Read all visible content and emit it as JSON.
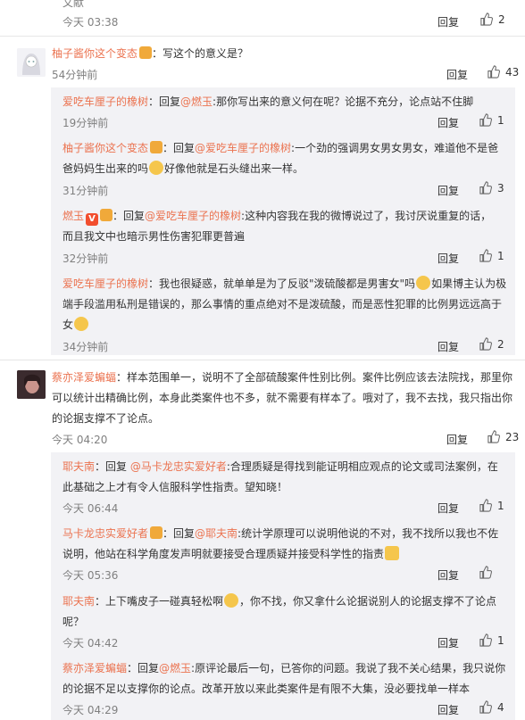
{
  "top": {
    "text": "文献",
    "time": "今天 03:38",
    "reply": "回复",
    "likes": "2"
  },
  "c1": {
    "user": "柚子酱你这个变态",
    "text": "：写这个的意义是？",
    "time": "54分钟前",
    "reply": "回复",
    "likes": "43",
    "replies": [
      {
        "user": "爱吃车厘子的橡树",
        "text1": "：回复",
        "mention": "@燃玉",
        "text2": ":那你写出来的意义何在呢？论据不充分，论点站不住脚",
        "time": "19分钟前",
        "reply": "回复",
        "likes": "1"
      },
      {
        "user": "柚子酱你这个变态",
        "text1": "：回复",
        "mention": "@爱吃车厘子的橡树",
        "text2": ":一个劲的强调男女男女男女，难道他不是爸",
        "line2a": "爸妈妈生出来的吗",
        "line2b": "好像他就是石头缝出来一样。",
        "time": "31分钟前",
        "reply": "回复",
        "likes": "3"
      },
      {
        "user": "燃玉",
        "text1": "：回复",
        "mention": "@爱吃车厘子的橡树",
        "text2": ":这种内容我在我的微博说过了，我讨厌说重复的话，",
        "line2": "而且我文中也暗示男性伤害犯罪更普遍",
        "vbadge": "V",
        "time": "32分钟前",
        "reply": "回复",
        "likes": "1"
      },
      {
        "user": "爱吃车厘子的橡树",
        "text1": "：我也很疑惑，就单单是为了反驳\"泼硫酸都是男害女\"吗",
        "text1b": "如果博主认为极",
        "line2": "端手段滥用私刑是错误的，那么事情的重点绝对不是泼硫酸，而是恶性犯罪的比例男远远高于",
        "line3": "女",
        "time": "34分钟前",
        "reply": "回复",
        "likes": "2"
      }
    ]
  },
  "c2": {
    "user": "蔡亦泽爱蝙蝠",
    "line1": "：样本范围单一，说明不了全部硫酸案件性别比例。案件比例应该去法院找，那里你",
    "line2": "可以统计出精确比例，本身此类案件也不多，就不需要有样本了。哦对了，我不去找，我只指出你",
    "line3": "的论据支撑不了论点。",
    "time": "今天 04:20",
    "reply": "回复",
    "likes": "23",
    "replies": [
      {
        "user": "耶夫南",
        "text1": "：回复 ",
        "mention": "@马卡龙忠实爱好者",
        "text2": ":合理质疑是得找到能证明相应观点的论文或司法案例，在",
        "line2": "此基础之上才有令人信服科学性指责。望知晓！",
        "time": "今天 06:44",
        "reply": "回复",
        "likes": "1"
      },
      {
        "user": "马卡龙忠实爱好者",
        "text1": "：回复",
        "mention": "@耶夫南",
        "text2": ":统计学原理可以说明他说的不对，我不找所以我也不佐",
        "line2": "说明，他站在科学角度发声明就要接受合理质疑并接受科学性的指责",
        "time": "今天 05:36",
        "reply": "回复",
        "likes": ""
      },
      {
        "user": "耶夫南",
        "text1": "：上下嘴皮子一碰真轻松啊",
        "text2": "，你不找，你又拿什么论据说别人的论据支撑不了论点",
        "line2": "呢？",
        "time": "今天 04:42",
        "reply": "回复",
        "likes": "1"
      },
      {
        "user": "蔡亦泽爱蝙蝠",
        "text1": "：回复",
        "mention": "@燃玉",
        "text2": ":原评论最后一句，已答你的问题。我说了我不关心结果，我只说你",
        "line2": "的论据不足以支撑你的论点。改革开放以来此类案件是有限不大集，没必要找单一样本",
        "time": "今天 04:29",
        "reply": "回复",
        "likes": "4"
      }
    ]
  }
}
